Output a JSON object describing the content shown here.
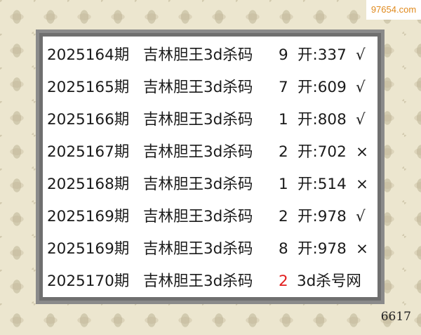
{
  "watermark": "97654.com",
  "footer_number": "6617",
  "colors": {
    "background": "#ece6cf",
    "frame": "#8a8a8a",
    "highlight": "#e21d1d",
    "watermark": "#e08a1e"
  },
  "rows": [
    {
      "issue": "2025164期",
      "name": "吉林胆王3d杀码",
      "kill": "9",
      "open": "开:337",
      "result": "√"
    },
    {
      "issue": "2025165期",
      "name": "吉林胆王3d杀码",
      "kill": "7",
      "open": "开:609",
      "result": "√"
    },
    {
      "issue": "2025166期",
      "name": "吉林胆王3d杀码",
      "kill": "1",
      "open": "开:808",
      "result": "√"
    },
    {
      "issue": "2025167期",
      "name": "吉林胆王3d杀码",
      "kill": "2",
      "open": "开:702",
      "result": "×"
    },
    {
      "issue": "2025168期",
      "name": "吉林胆王3d杀码",
      "kill": "1",
      "open": "开:514",
      "result": "×"
    },
    {
      "issue": "2025169期",
      "name": "吉林胆王3d杀码",
      "kill": "2",
      "open": "开:978",
      "result": "√"
    },
    {
      "issue": "2025169期",
      "name": "吉林胆王3d杀码",
      "kill": "8",
      "open": "开:978",
      "result": "×"
    }
  ],
  "current": {
    "issue": "2025170期",
    "name": "吉林胆王3d杀码",
    "kill": "2",
    "site": "3d杀号网"
  }
}
